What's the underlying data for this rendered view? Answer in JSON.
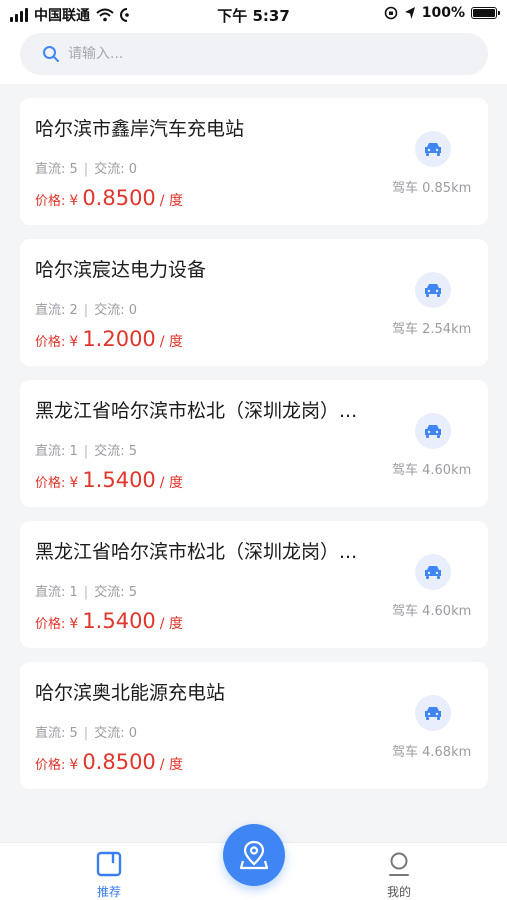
{
  "status_bar": {
    "carrier": "中国联通",
    "time": "下午 5:37",
    "battery": "100%"
  },
  "search": {
    "placeholder": "请输入..."
  },
  "stations": [
    {
      "name": "哈尔滨市鑫岸汽车充电站",
      "dc_label": "直流: 5",
      "ac_label": "交流: 0",
      "price_label": "价格:",
      "currency": "¥",
      "price": "0.8500",
      "unit": "/ 度",
      "distance": "驾车 0.85km"
    },
    {
      "name": "哈尔滨宸达电力设备",
      "dc_label": "直流: 2",
      "ac_label": "交流: 0",
      "price_label": "价格:",
      "currency": "¥",
      "price": "1.2000",
      "unit": "/ 度",
      "distance": "驾车 2.54km"
    },
    {
      "name": "黑龙江省哈尔滨市松北（深圳龙岗）...",
      "dc_label": "直流: 1",
      "ac_label": "交流: 5",
      "price_label": "价格:",
      "currency": "¥",
      "price": "1.5400",
      "unit": "/ 度",
      "distance": "驾车 4.60km"
    },
    {
      "name": "黑龙江省哈尔滨市松北（深圳龙岗）...",
      "dc_label": "直流: 1",
      "ac_label": "交流: 5",
      "price_label": "价格:",
      "currency": "¥",
      "price": "1.5400",
      "unit": "/ 度",
      "distance": "驾车 4.60km"
    },
    {
      "name": "哈尔滨奥北能源充电站",
      "dc_label": "直流: 5",
      "ac_label": "交流: 0",
      "price_label": "价格:",
      "currency": "¥",
      "price": "0.8500",
      "unit": "/ 度",
      "distance": "驾车 4.68km"
    }
  ],
  "tabbar": {
    "recommend_label": "推荐",
    "mine_label": "我的"
  },
  "colors": {
    "accent": "#3f86f4",
    "price": "#e0362c",
    "muted": "#9a9ca2"
  },
  "icons": {
    "search": "search-icon",
    "car": "car-icon",
    "map": "map-pin-icon",
    "recommend": "recommend-icon",
    "mine": "user-icon"
  }
}
